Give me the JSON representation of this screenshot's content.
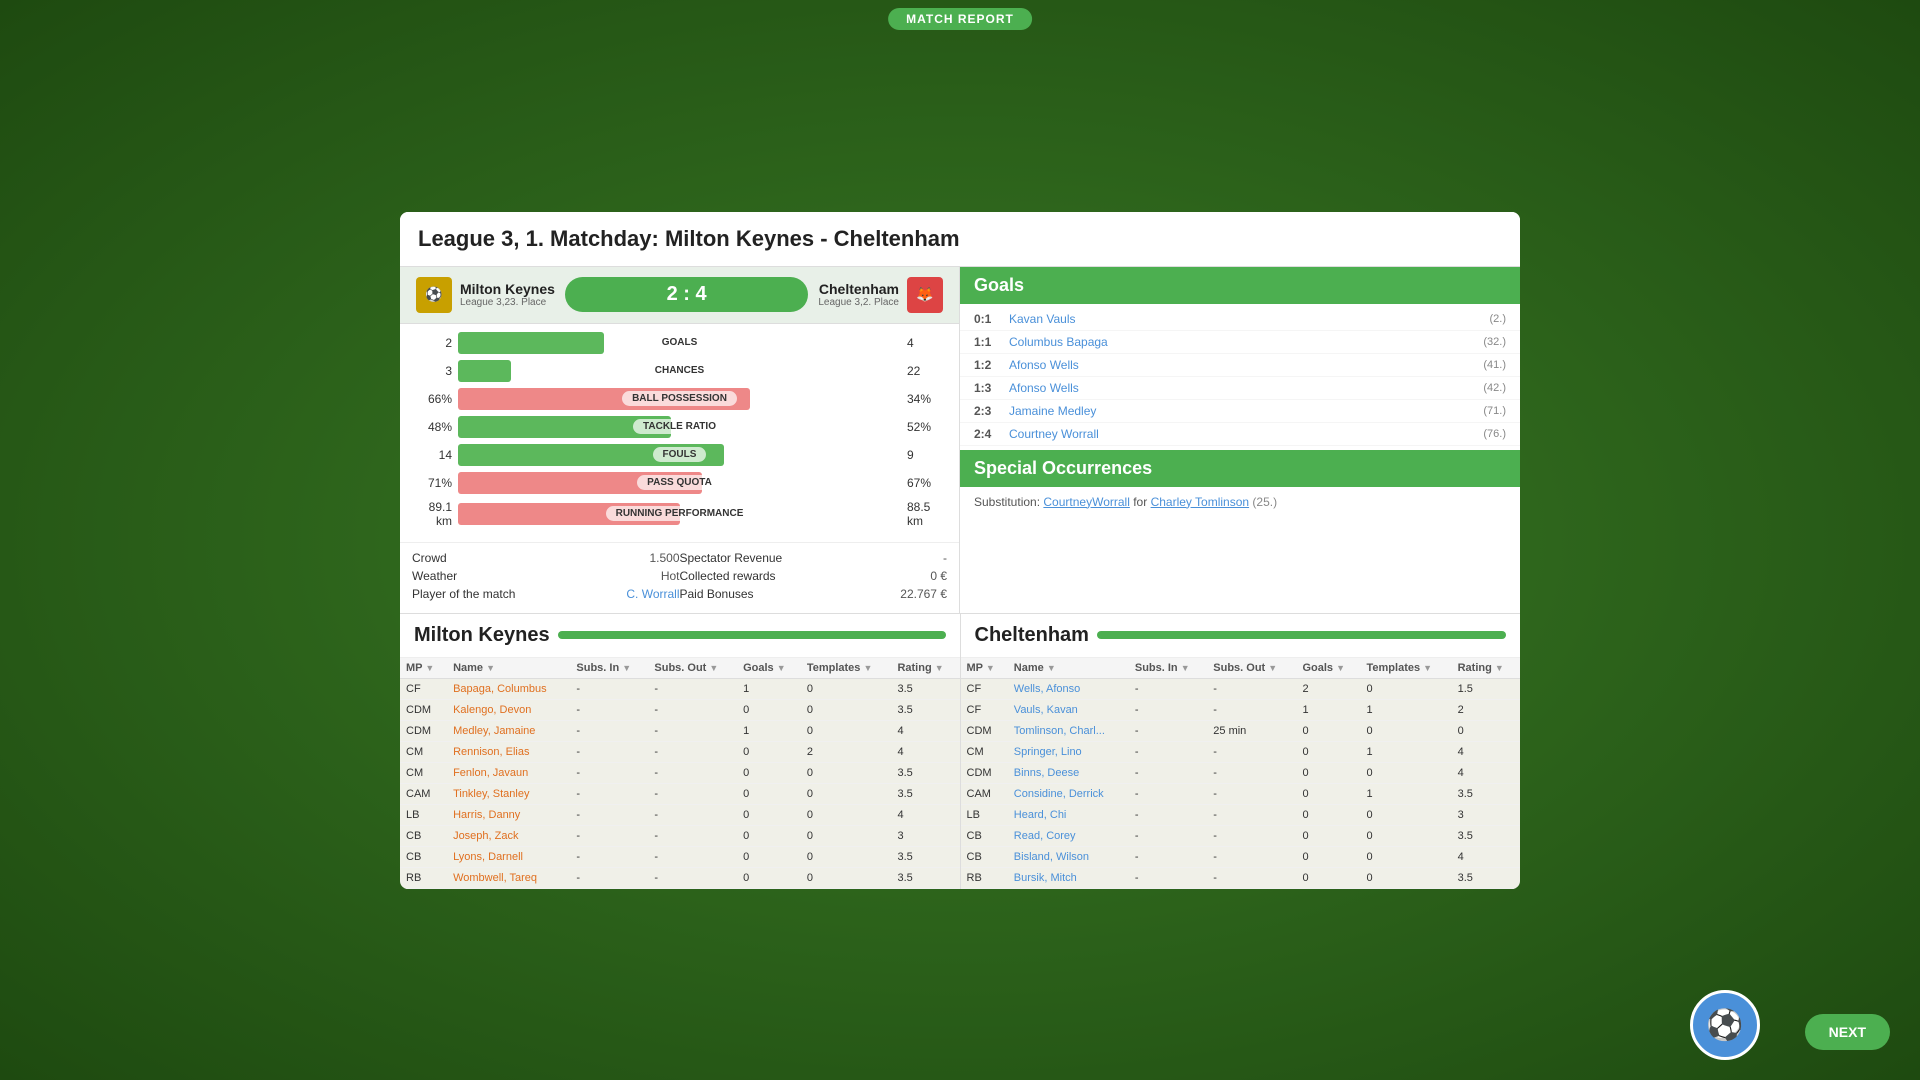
{
  "header": {
    "match_report_label": "MATCH REPORT"
  },
  "title": "League 3, 1. Matchday: Milton Keynes - Cheltenham",
  "teams": {
    "home": {
      "name": "Milton Keynes",
      "league": "League 3,23. Place",
      "score": 2
    },
    "away": {
      "name": "Cheltenham",
      "league": "League 3,2. Place",
      "score": 4
    },
    "score_display": "2 : 4"
  },
  "stats": [
    {
      "left": "2",
      "label": "GOALS",
      "right": "4",
      "left_pct": 33,
      "type": "green"
    },
    {
      "left": "3",
      "label": "CHANCES",
      "right": "22",
      "left_pct": 12,
      "type": "green"
    },
    {
      "left": "66%",
      "label": "BALL POSSESSION",
      "right": "34%",
      "left_pct": 66,
      "type": "red"
    },
    {
      "left": "48%",
      "label": "TACKLE RATIO",
      "right": "52%",
      "left_pct": 48,
      "type": "green"
    },
    {
      "left": "14",
      "label": "FOULS",
      "right": "9",
      "left_pct": 60,
      "type": "green"
    },
    {
      "left": "71%",
      "label": "PASS QUOTA",
      "right": "67%",
      "left_pct": 55,
      "type": "red"
    },
    {
      "left": "89.1 km",
      "label": "RUNNING PERFORMANCE",
      "right": "88.5 km",
      "left_pct": 50,
      "type": "red"
    }
  ],
  "info": {
    "crowd_label": "Crowd",
    "crowd_val": "1.500",
    "weather_label": "Weather",
    "weather_val": "Hot",
    "player_match_label": "Player of the match",
    "player_match_val": "C. Worrall",
    "spectator_revenue_label": "Spectator Revenue",
    "spectator_revenue_val": "-",
    "collected_rewards_label": "Collected rewards",
    "collected_rewards_val": "0 €",
    "paid_bonuses_label": "Paid Bonuses",
    "paid_bonuses_val": "22.767 €"
  },
  "goals_section": {
    "title": "Goals",
    "goals": [
      {
        "score": "0:1",
        "player": "Kavan Vauls",
        "minute": "(2.)"
      },
      {
        "score": "1:1",
        "player": "Columbus Bapaga",
        "minute": "(32.)"
      },
      {
        "score": "1:2",
        "player": "Afonso Wells",
        "minute": "(41.)"
      },
      {
        "score": "1:3",
        "player": "Afonso Wells",
        "minute": "(42.)"
      },
      {
        "score": "2:3",
        "player": "Jamaine Medley",
        "minute": "(71.)"
      },
      {
        "score": "2:4",
        "player": "Courtney Worrall",
        "minute": "(76.)"
      }
    ]
  },
  "special_occurrences": {
    "title": "Special Occurrences",
    "items": [
      {
        "label": "Substitution:",
        "player1": "CourtneyWorrall",
        "connector": "for",
        "player2": "Charley Tomlinson",
        "minute": "(25.)"
      }
    ]
  },
  "home_team": {
    "name": "Milton Keynes",
    "columns": [
      "MP",
      "Name",
      "Subs. In",
      "Subs. Out",
      "Goals",
      "Templates",
      "Rating"
    ],
    "players": [
      {
        "pos": "CF",
        "name": "Bapaga, Columbus",
        "subs_in": "-",
        "subs_out": "-",
        "goals": "1",
        "templates": "0",
        "rating": "3.5",
        "highlight": true
      },
      {
        "pos": "CDM",
        "name": "Kalengo, Devon",
        "subs_in": "-",
        "subs_out": "-",
        "goals": "0",
        "templates": "0",
        "rating": "3.5",
        "highlight": true
      },
      {
        "pos": "CDM",
        "name": "Medley, Jamaine",
        "subs_in": "-",
        "subs_out": "-",
        "goals": "1",
        "templates": "0",
        "rating": "4",
        "highlight": true
      },
      {
        "pos": "CM",
        "name": "Rennison, Elias",
        "subs_in": "-",
        "subs_out": "-",
        "goals": "0",
        "templates": "2",
        "rating": "4",
        "highlight": true
      },
      {
        "pos": "CM",
        "name": "Fenlon, Javaun",
        "subs_in": "-",
        "subs_out": "-",
        "goals": "0",
        "templates": "0",
        "rating": "3.5",
        "highlight": true
      },
      {
        "pos": "CAM",
        "name": "Tinkley, Stanley",
        "subs_in": "-",
        "subs_out": "-",
        "goals": "0",
        "templates": "0",
        "rating": "3.5",
        "highlight": true
      },
      {
        "pos": "LB",
        "name": "Harris, Danny",
        "subs_in": "-",
        "subs_out": "-",
        "goals": "0",
        "templates": "0",
        "rating": "4",
        "highlight": true
      },
      {
        "pos": "CB",
        "name": "Joseph, Zack",
        "subs_in": "-",
        "subs_out": "-",
        "goals": "0",
        "templates": "0",
        "rating": "3",
        "highlight": true
      },
      {
        "pos": "CB",
        "name": "Lyons, Darnell",
        "subs_in": "-",
        "subs_out": "-",
        "goals": "0",
        "templates": "0",
        "rating": "3.5",
        "highlight": true
      },
      {
        "pos": "RB",
        "name": "Wombwell, Tareq",
        "subs_in": "-",
        "subs_out": "-",
        "goals": "0",
        "templates": "0",
        "rating": "3.5",
        "highlight": true
      }
    ]
  },
  "away_team": {
    "name": "Cheltenham",
    "columns": [
      "MP",
      "Name",
      "Subs. In",
      "Subs. Out",
      "Goals",
      "Templates",
      "Rating"
    ],
    "players": [
      {
        "pos": "CF",
        "name": "Wells, Afonso",
        "subs_in": "-",
        "subs_out": "-",
        "goals": "2",
        "templates": "0",
        "rating": "1.5",
        "highlight": false
      },
      {
        "pos": "CF",
        "name": "Vauls, Kavan",
        "subs_in": "-",
        "subs_out": "-",
        "goals": "1",
        "templates": "1",
        "rating": "2",
        "highlight": false
      },
      {
        "pos": "CDM",
        "name": "Tomlinson, Charl...",
        "subs_in": "-",
        "subs_out": "25 min",
        "goals": "0",
        "templates": "0",
        "rating": "0",
        "highlight": false
      },
      {
        "pos": "CM",
        "name": "Springer, Lino",
        "subs_in": "-",
        "subs_out": "-",
        "goals": "0",
        "templates": "1",
        "rating": "4",
        "highlight": false
      },
      {
        "pos": "CDM",
        "name": "Binns, Deese",
        "subs_in": "-",
        "subs_out": "-",
        "goals": "0",
        "templates": "0",
        "rating": "4",
        "highlight": false
      },
      {
        "pos": "CAM",
        "name": "Considine, Derrick",
        "subs_in": "-",
        "subs_out": "-",
        "goals": "0",
        "templates": "1",
        "rating": "3.5",
        "highlight": false
      },
      {
        "pos": "LB",
        "name": "Heard, Chi",
        "subs_in": "-",
        "subs_out": "-",
        "goals": "0",
        "templates": "0",
        "rating": "3",
        "highlight": false
      },
      {
        "pos": "CB",
        "name": "Read, Corey",
        "subs_in": "-",
        "subs_out": "-",
        "goals": "0",
        "templates": "0",
        "rating": "3.5",
        "highlight": false
      },
      {
        "pos": "CB",
        "name": "Bisland, Wilson",
        "subs_in": "-",
        "subs_out": "-",
        "goals": "0",
        "templates": "0",
        "rating": "4",
        "highlight": false
      },
      {
        "pos": "RB",
        "name": "Bursik, Mitch",
        "subs_in": "-",
        "subs_out": "-",
        "goals": "0",
        "templates": "0",
        "rating": "3.5",
        "highlight": false
      }
    ]
  },
  "next_button": "NEXT"
}
